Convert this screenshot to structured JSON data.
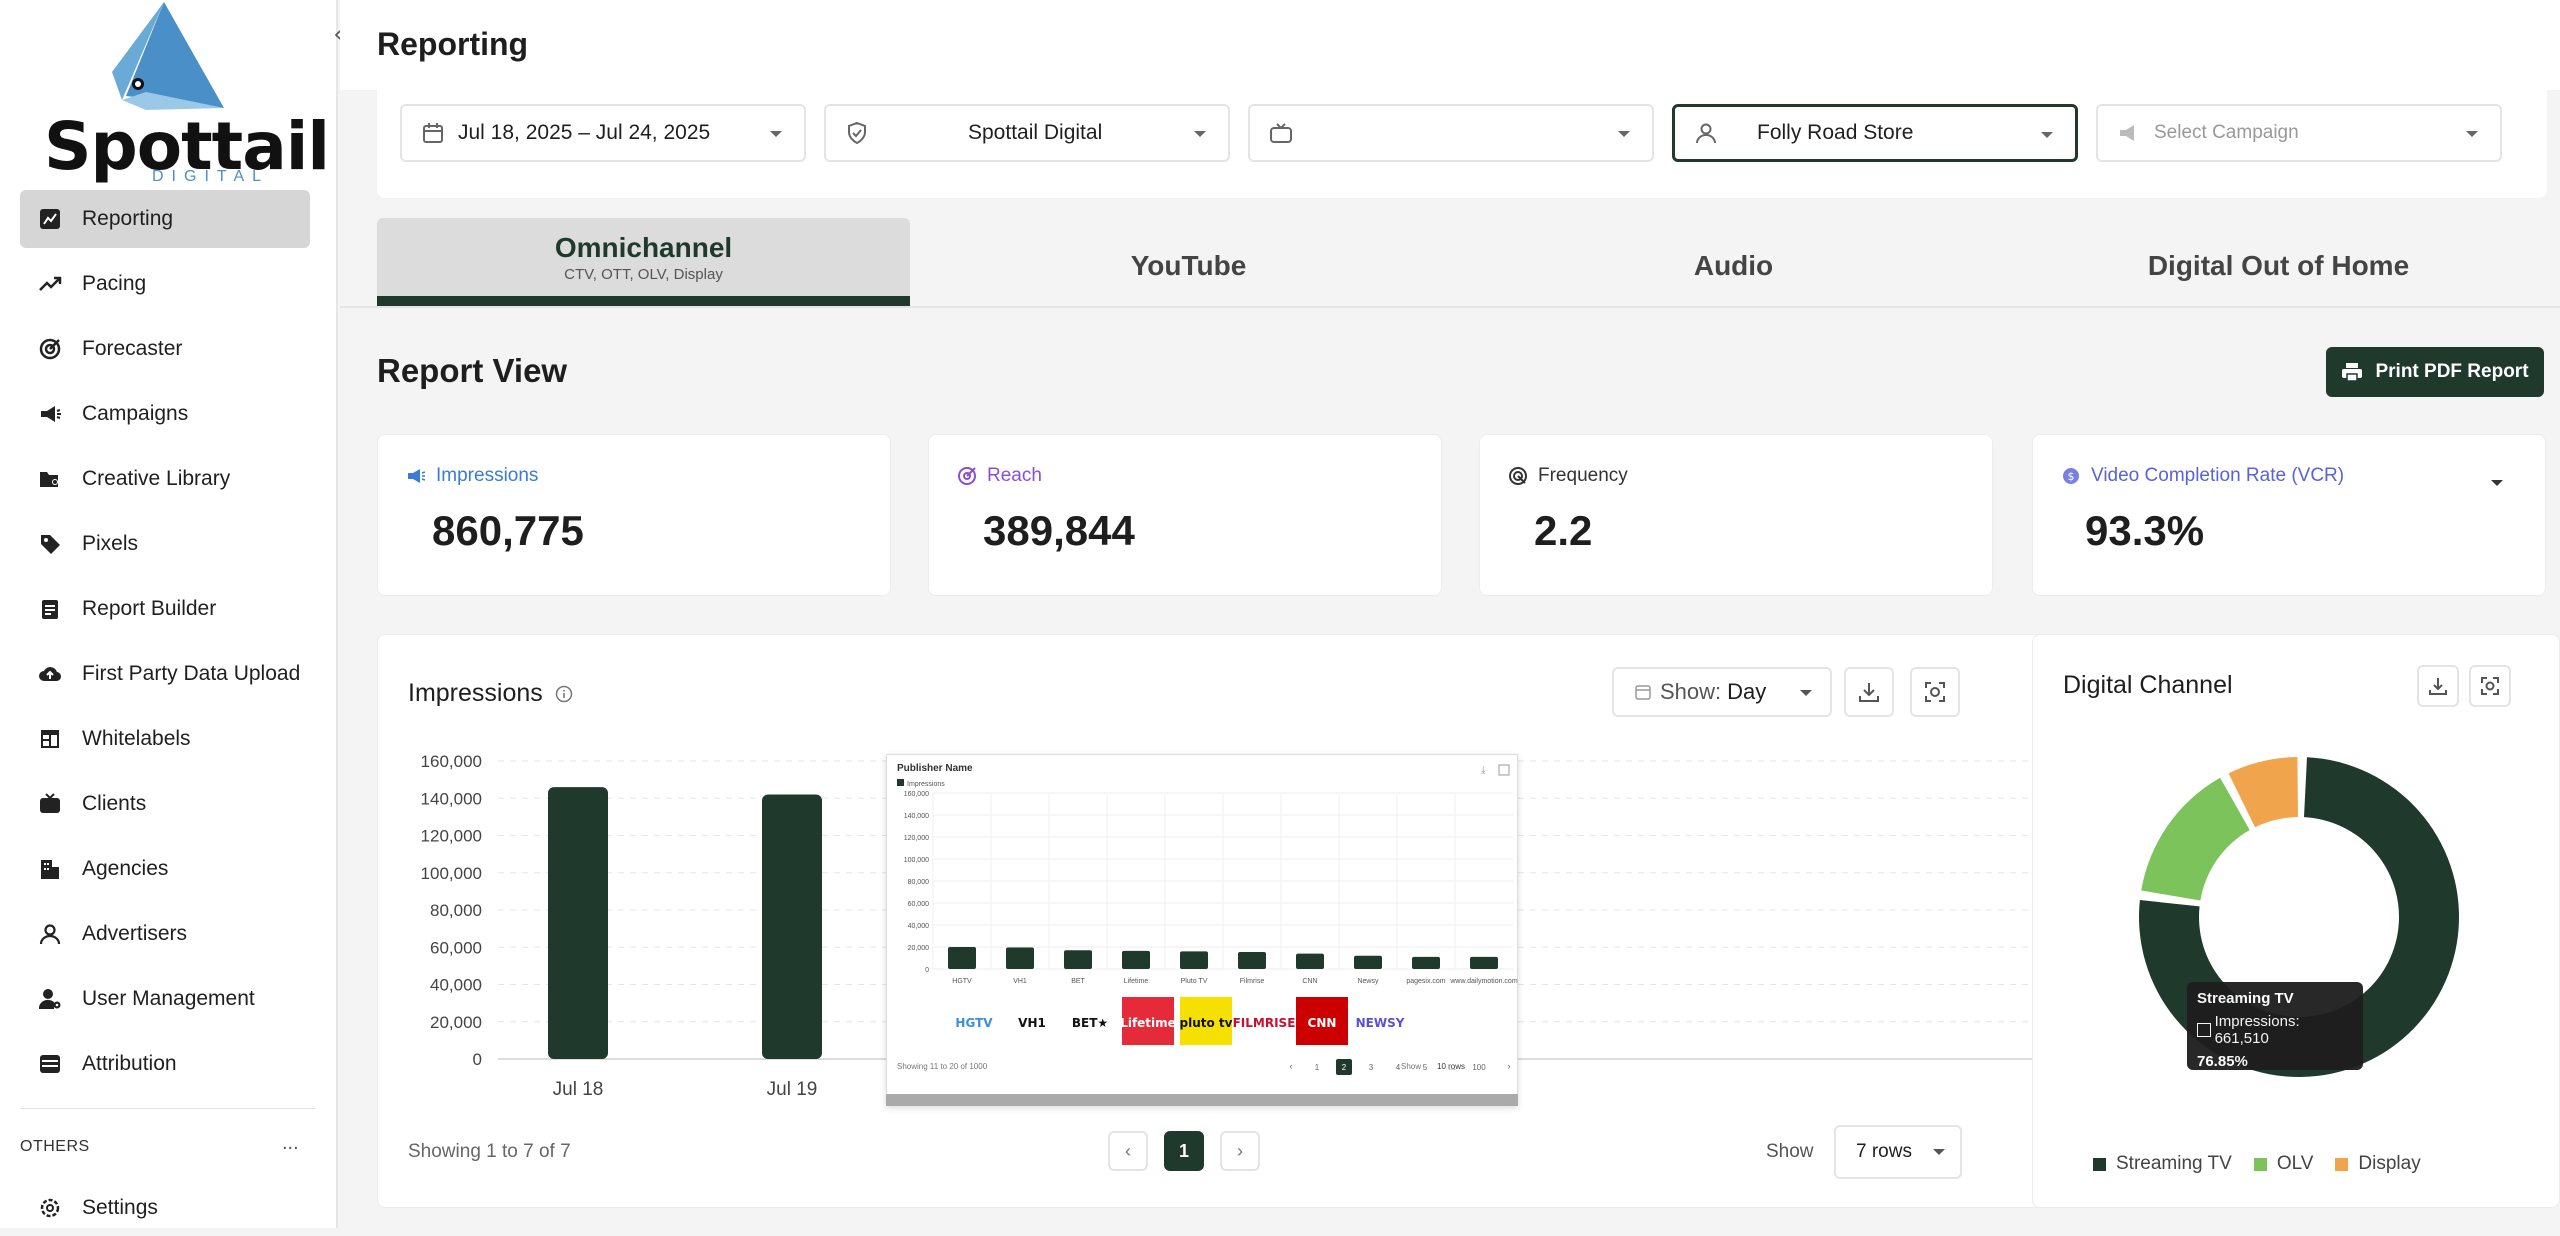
{
  "sidebar": {
    "logo_text": "Spottail",
    "logo_sub": "DIGITAL",
    "items": [
      {
        "label": "Reporting",
        "icon": "chart-icon"
      },
      {
        "label": "Pacing",
        "icon": "trend-icon"
      },
      {
        "label": "Forecaster",
        "icon": "target-icon"
      },
      {
        "label": "Campaigns",
        "icon": "megaphone-icon"
      },
      {
        "label": "Creative Library",
        "icon": "folder-user-icon"
      },
      {
        "label": "Pixels",
        "icon": "tag-icon"
      },
      {
        "label": "Report Builder",
        "icon": "clipboard-icon"
      },
      {
        "label": "First Party Data Upload",
        "icon": "cloud-upload-icon"
      },
      {
        "label": "Whitelabels",
        "icon": "layout-icon"
      },
      {
        "label": "Clients",
        "icon": "tv-icon"
      },
      {
        "label": "Agencies",
        "icon": "building-icon"
      },
      {
        "label": "Advertisers",
        "icon": "person-icon"
      },
      {
        "label": "User Management",
        "icon": "users-gear-icon"
      },
      {
        "label": "Attribution",
        "icon": "window-icon"
      }
    ],
    "others_label": "OTHERS",
    "others_more": "...",
    "settings_label": "Settings"
  },
  "header": {
    "title": "Reporting"
  },
  "filters": {
    "date": "Jul 18, 2025 – Jul 24, 2025",
    "org": "Spottail Digital",
    "channel": "",
    "advertiser": "Folly Road  Store",
    "campaign_placeholder": "Select Campaign"
  },
  "tabs": [
    {
      "label": "Omnichannel",
      "sub": "CTV, OTT, OLV, Display"
    },
    {
      "label": "YouTube",
      "sub": ""
    },
    {
      "label": "Audio",
      "sub": ""
    },
    {
      "label": "Digital Out of Home",
      "sub": ""
    }
  ],
  "report": {
    "title": "Report View",
    "print_label": "Print PDF Report"
  },
  "kpis": [
    {
      "label": "Impressions",
      "value": "860,775",
      "color": "#3a7bd5"
    },
    {
      "label": "Reach",
      "value": "389,844",
      "color": "#8a4fd8"
    },
    {
      "label": "Frequency",
      "value": "2.2",
      "color": "#333333"
    },
    {
      "label": "Video Completion Rate (VCR)",
      "value": "93.3%",
      "color": "#5a62d8"
    }
  ],
  "impressions_panel": {
    "title": "Impressions",
    "show_prefix": "Show:",
    "show_value": "Day",
    "footer": "Showing 1 to 7 of 7",
    "page": "1",
    "rows_label": "Show",
    "rows_value": "7 rows"
  },
  "chart_data": [
    {
      "type": "bar",
      "title": "Impressions",
      "categories": [
        "Jul 18",
        "Jul 19"
      ],
      "values": [
        146000,
        142000
      ],
      "ylim": [
        0,
        160000
      ],
      "yticks": [
        "160,000",
        "140,000",
        "120,000",
        "100,000",
        "80,000",
        "60,000",
        "40,000",
        "20,000",
        "0"
      ],
      "color": "#1f3a2d",
      "grid": true
    },
    {
      "type": "bar",
      "title": "Publisher Name",
      "legend": "Impressions",
      "categories": [
        "HGTV",
        "VH1",
        "BET",
        "Lifetime",
        "Pluto TV",
        "Filmrise",
        "CNN",
        "Newsy",
        "pagesix.com",
        "www.dailymotion.com"
      ],
      "values": [
        20000,
        19500,
        17000,
        16500,
        16000,
        15500,
        14000,
        12000,
        11000,
        11000
      ],
      "ylim": [
        0,
        160000
      ],
      "yticks": [
        "160,000",
        "140,000",
        "120,000",
        "100,000",
        "80,000",
        "60,000",
        "40,000",
        "20,000",
        "0"
      ],
      "color": "#1f3a2d"
    },
    {
      "type": "pie",
      "title": "Digital Channel",
      "categories": [
        "Streaming TV",
        "OLV",
        "Display"
      ],
      "values": [
        661510,
        130000,
        69265
      ],
      "colors": [
        "#1f3a2d",
        "#7cc35c",
        "#f0a54c"
      ],
      "legend_position": "bottom"
    }
  ],
  "inset": {
    "logos": [
      "HGTV",
      "VH1",
      "BET★",
      "Lifetime",
      "pluto tv",
      "FILMRISE",
      "CNN",
      "NEWSY"
    ],
    "footer": "Showing 11 to 20 of 1000",
    "pages": [
      "1",
      "2",
      "3",
      "4",
      "5",
      "...",
      "100"
    ],
    "current_page": "2",
    "show": "Show",
    "rows": "10 rows"
  },
  "donut_panel": {
    "title": "Digital Channel",
    "tooltip_title": "Streaming TV",
    "tooltip_line": "Impressions: 661,510",
    "tooltip_pct": "76.85%"
  }
}
